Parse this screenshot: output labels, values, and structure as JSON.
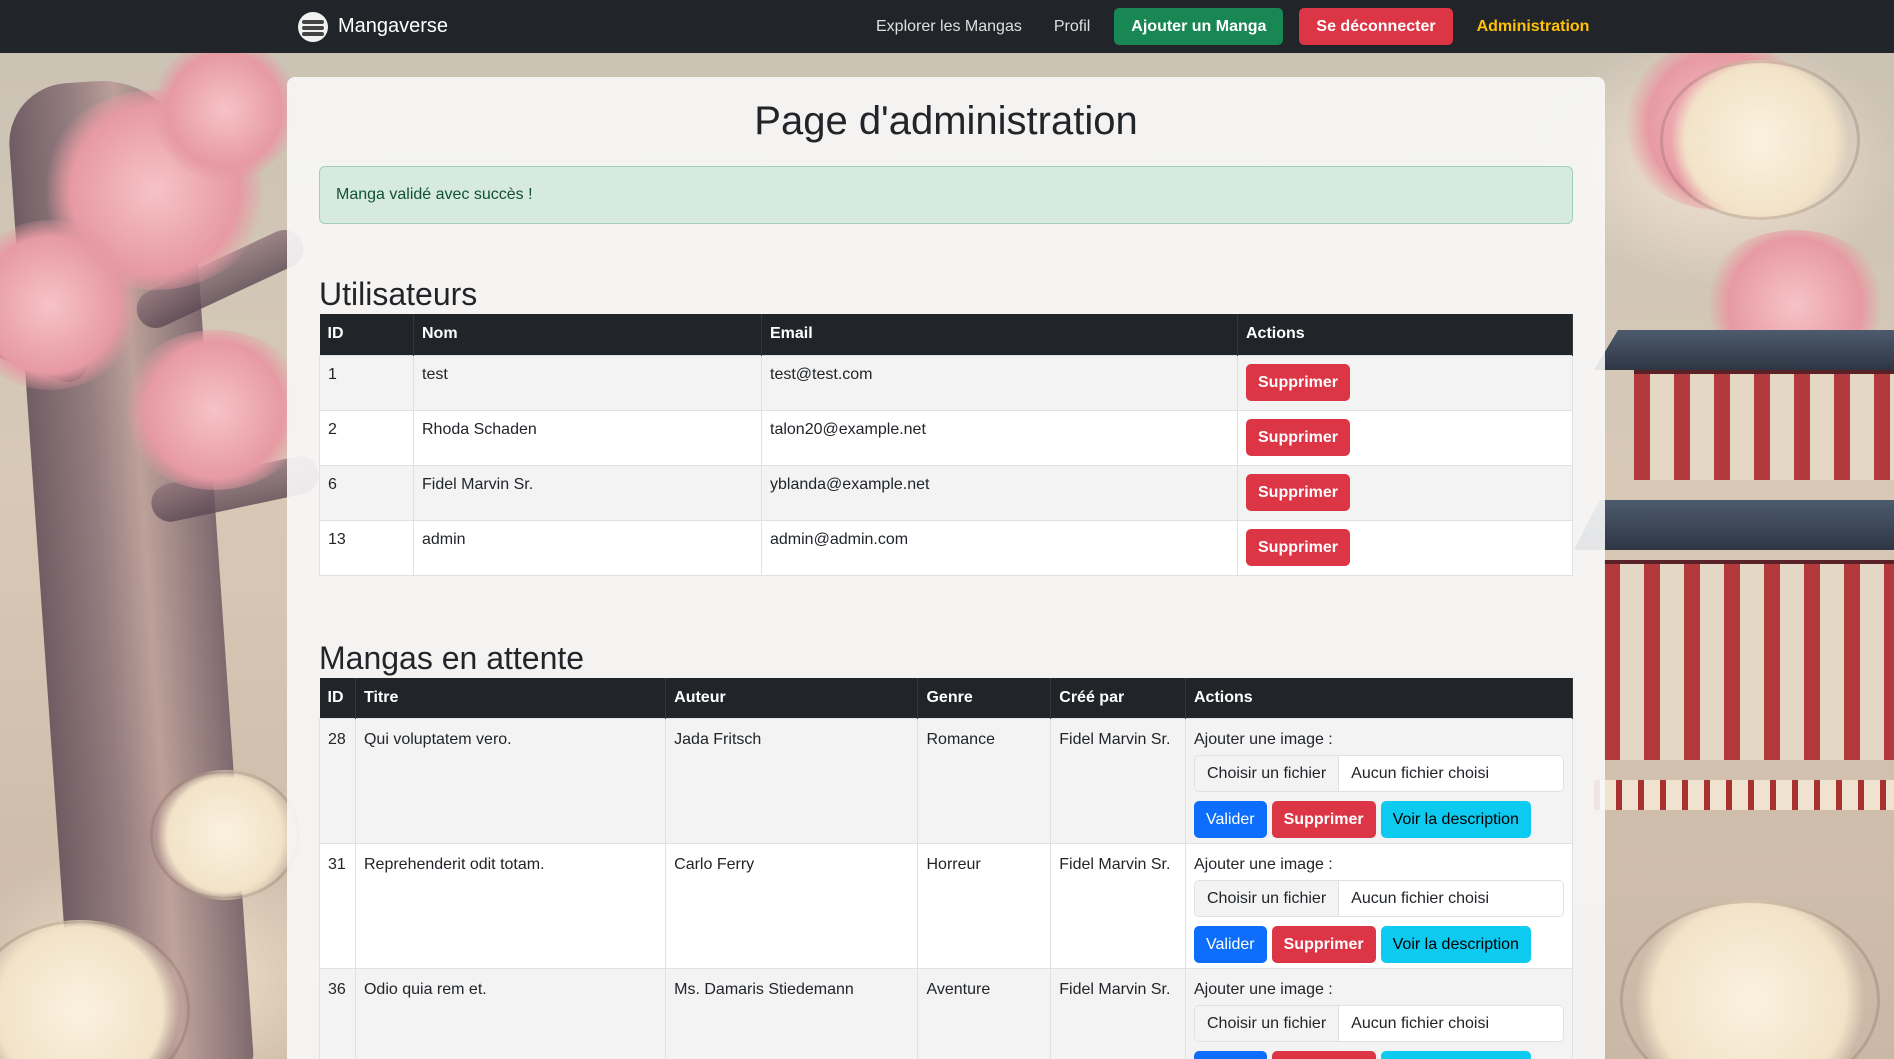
{
  "navbar": {
    "brand": "Mangaverse",
    "links": [
      "Explorer les Mangas",
      "Profil"
    ],
    "add_manga": "Ajouter un Manga",
    "logout": "Se déconnecter",
    "admin": "Administration"
  },
  "page_title": "Page d'administration",
  "alert": "Manga validé avec succès !",
  "users_section": {
    "title": "Utilisateurs",
    "headers": [
      "ID",
      "Nom",
      "Email",
      "Actions"
    ],
    "rows": [
      {
        "id": "1",
        "name": "test",
        "email": "test@test.com",
        "action": "Supprimer"
      },
      {
        "id": "2",
        "name": "Rhoda Schaden",
        "email": "talon20@example.net",
        "action": "Supprimer"
      },
      {
        "id": "6",
        "name": "Fidel Marvin Sr.",
        "email": "yblanda@example.net",
        "action": "Supprimer"
      },
      {
        "id": "13",
        "name": "admin",
        "email": "admin@admin.com",
        "action": "Supprimer"
      }
    ]
  },
  "mangas_section": {
    "title": "Mangas en attente",
    "headers": [
      "ID",
      "Titre",
      "Auteur",
      "Genre",
      "Créé par",
      "Actions"
    ],
    "image_label": "Ajouter une image :",
    "file_button": "Choisir un fichier",
    "file_placeholder": "Aucun fichier choisi",
    "validate": "Valider",
    "delete": "Supprimer",
    "view_description": "Voir la description",
    "rows": [
      {
        "id": "28",
        "title": "Qui voluptatem vero.",
        "author": "Jada Fritsch",
        "genre": "Romance",
        "created_by": "Fidel Marvin Sr."
      },
      {
        "id": "31",
        "title": "Reprehenderit odit totam.",
        "author": "Carlo Ferry",
        "genre": "Horreur",
        "created_by": "Fidel Marvin Sr."
      },
      {
        "id": "36",
        "title": "Odio quia rem et.",
        "author": "Ms. Damaris Stiedemann",
        "genre": "Aventure",
        "created_by": "Fidel Marvin Sr."
      }
    ]
  },
  "colors": {
    "navbar": "#212529",
    "success": "#198754",
    "danger": "#dc3545",
    "primary": "#0d6efd",
    "info": "#0dcaf0",
    "warning": "#ffc107"
  }
}
